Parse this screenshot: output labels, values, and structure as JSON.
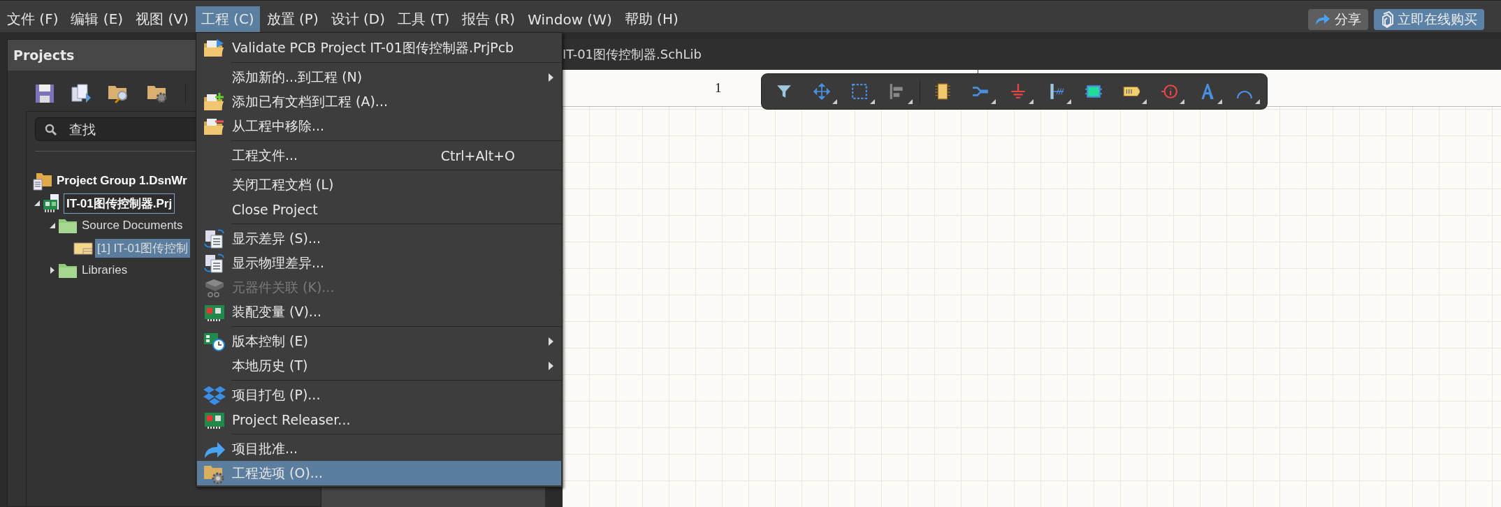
{
  "menubar": {
    "items": [
      {
        "label": "文件 (F)",
        "selected": false
      },
      {
        "label": "编辑 (E)",
        "selected": false
      },
      {
        "label": "视图 (V)",
        "selected": false
      },
      {
        "label": "工程 (C)",
        "selected": true
      },
      {
        "label": "放置 (P)",
        "selected": false
      },
      {
        "label": "设计 (D)",
        "selected": false
      },
      {
        "label": "工具 (T)",
        "selected": false
      },
      {
        "label": "报告 (R)",
        "selected": false
      },
      {
        "label": "Window (W)",
        "selected": false
      },
      {
        "label": "帮助 (H)",
        "selected": false
      }
    ],
    "share_button": "分享",
    "buy_button": "立即在线购买"
  },
  "projects_panel": {
    "title": "Projects",
    "search": {
      "placeholder": "查找"
    },
    "tree": [
      {
        "label": "Project Group 1.DsnWr",
        "kind": "group",
        "selected": false,
        "focused": false,
        "children": [
          {
            "label": "IT-01图传控制器.Prj",
            "kind": "project",
            "expanded": true,
            "selected": false,
            "focused": true,
            "children": [
              {
                "label": "Source Documents",
                "kind": "folder",
                "expanded": true,
                "selected": false,
                "focused": false,
                "children": [
                  {
                    "label": "[1] IT-01图传控制",
                    "kind": "schematic",
                    "selected": true,
                    "focused": false
                  }
                ]
              },
              {
                "label": "Libraries",
                "kind": "folder",
                "expanded": false,
                "selected": false,
                "focused": false
              }
            ]
          }
        ]
      }
    ]
  },
  "document": {
    "tab": "IT-01图传控制器.SchLib",
    "column_label": "1"
  },
  "project_menu": [
    {
      "kind": "item",
      "label": "Validate PCB Project IT-01图传控制器.PrjPcb",
      "submenu": false,
      "disabled": false,
      "selected": false
    },
    {
      "kind": "separator"
    },
    {
      "kind": "item",
      "label": "添加新的...到工程 (N)",
      "submenu": true,
      "disabled": false,
      "selected": false
    },
    {
      "kind": "item",
      "label": "添加已有文档到工程 (A)...",
      "submenu": false,
      "disabled": false,
      "selected": false
    },
    {
      "kind": "item",
      "label": "从工程中移除...",
      "submenu": false,
      "disabled": false,
      "selected": false
    },
    {
      "kind": "separator"
    },
    {
      "kind": "item",
      "label": "工程文件...",
      "shortcut": "Ctrl+Alt+O",
      "submenu": false,
      "disabled": false,
      "selected": false
    },
    {
      "kind": "separator"
    },
    {
      "kind": "item",
      "label": "关闭工程文档 (L)",
      "submenu": false,
      "disabled": false,
      "selected": false
    },
    {
      "kind": "item",
      "label": "Close Project",
      "submenu": false,
      "disabled": false,
      "selected": false
    },
    {
      "kind": "separator"
    },
    {
      "kind": "item",
      "label": "显示差异 (S)...",
      "submenu": false,
      "disabled": false,
      "selected": false
    },
    {
      "kind": "item",
      "label": "显示物理差异...",
      "submenu": false,
      "disabled": false,
      "selected": false
    },
    {
      "kind": "item",
      "label": "元器件关联 (K)...",
      "submenu": false,
      "disabled": true,
      "selected": false
    },
    {
      "kind": "item",
      "label": "装配变量 (V)...",
      "submenu": false,
      "disabled": false,
      "selected": false
    },
    {
      "kind": "separator"
    },
    {
      "kind": "item",
      "label": "版本控制 (E)",
      "submenu": true,
      "disabled": false,
      "selected": false
    },
    {
      "kind": "item",
      "label": "本地历史 (T)",
      "submenu": true,
      "disabled": false,
      "selected": false
    },
    {
      "kind": "separator"
    },
    {
      "kind": "item",
      "label": "项目打包 (P)...",
      "submenu": false,
      "disabled": false,
      "selected": false
    },
    {
      "kind": "item",
      "label": "Project Releaser...",
      "submenu": false,
      "disabled": false,
      "selected": false
    },
    {
      "kind": "separator"
    },
    {
      "kind": "item",
      "label": "项目批准...",
      "submenu": false,
      "disabled": false,
      "selected": false
    },
    {
      "kind": "item",
      "label": "工程选项 (O)...",
      "submenu": false,
      "disabled": false,
      "selected": true
    }
  ]
}
